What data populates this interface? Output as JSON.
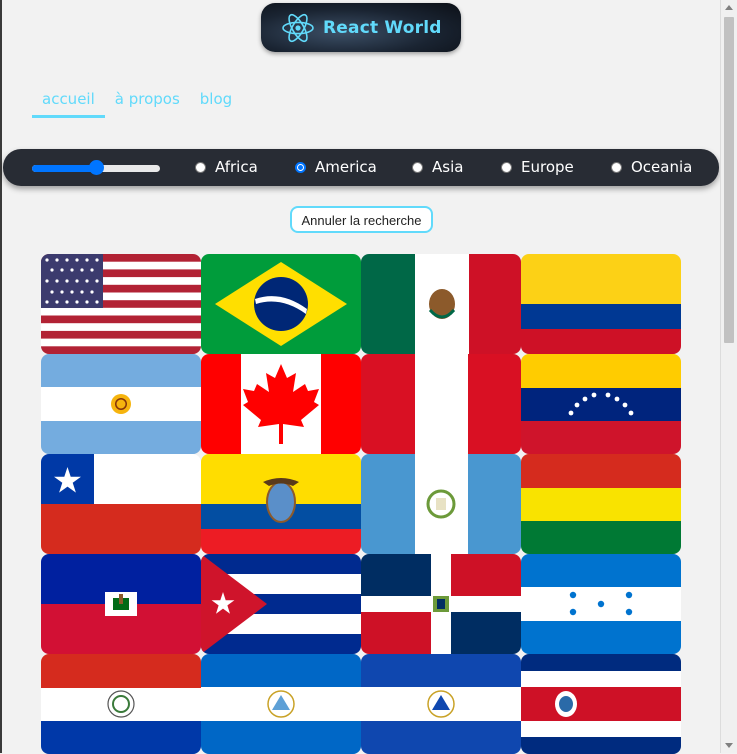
{
  "app": {
    "logo_text": "React World",
    "logo_icon": "react-atom-icon"
  },
  "nav": {
    "items": [
      {
        "label": "accueil",
        "active": true
      },
      {
        "label": "à propos",
        "active": false
      },
      {
        "label": "blog",
        "active": false
      }
    ]
  },
  "filters": {
    "range_value_fraction": 0.5,
    "regions": [
      {
        "label": "Africa",
        "checked": false
      },
      {
        "label": "America",
        "checked": true
      },
      {
        "label": "Asia",
        "checked": false
      },
      {
        "label": "Europe",
        "checked": false
      },
      {
        "label": "Oceania",
        "checked": false
      }
    ]
  },
  "search": {
    "cancel_label": "Annuler la recherche"
  },
  "flags": [
    {
      "country": "United States"
    },
    {
      "country": "Brazil"
    },
    {
      "country": "Mexico"
    },
    {
      "country": "Colombia"
    },
    {
      "country": "Argentina"
    },
    {
      "country": "Canada"
    },
    {
      "country": "Peru"
    },
    {
      "country": "Venezuela"
    },
    {
      "country": "Chile"
    },
    {
      "country": "Ecuador"
    },
    {
      "country": "Guatemala"
    },
    {
      "country": "Bolivia"
    },
    {
      "country": "Haiti"
    },
    {
      "country": "Cuba"
    },
    {
      "country": "Dominican Republic"
    },
    {
      "country": "Honduras"
    },
    {
      "country": "Paraguay"
    },
    {
      "country": "Nicaragua"
    },
    {
      "country": "El Salvador"
    },
    {
      "country": "Costa Rica"
    }
  ],
  "colors": {
    "accent": "#61dafb",
    "bar": "#282c34",
    "radio": "#0075ff",
    "background": "#f2f2f2"
  }
}
